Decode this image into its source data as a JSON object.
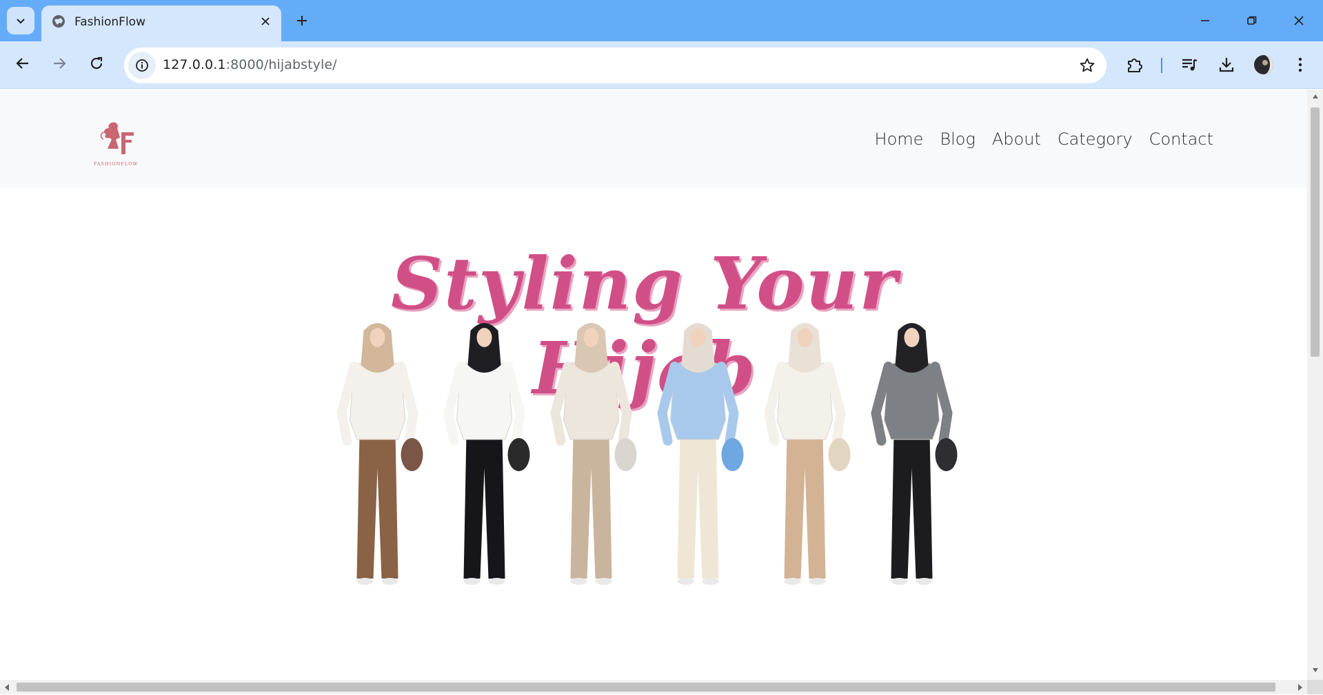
{
  "browser": {
    "tab": {
      "title": "FashionFlow",
      "icon": "globe-icon"
    },
    "address": {
      "host": "127.0.0.1",
      "path": ":8000/hijabstyle/"
    },
    "colors": {
      "tabstrip": "#64acf8",
      "toolbar": "#d5e7fc"
    }
  },
  "site": {
    "logo_text": "FASHIONFLOW",
    "nav": {
      "home": "Home",
      "blog": "Blog",
      "about": "About",
      "category": "Category",
      "contact": "Contact"
    },
    "hero": {
      "title": "Styling Your Hijab",
      "accent_color": "#d14f87",
      "outfits": [
        {
          "icon": "model-icon",
          "top": "#f4f1ec",
          "hijab": "#d2b79a",
          "pants": "#8a6246",
          "bag": "#7a5646"
        },
        {
          "icon": "model-icon",
          "top": "#f6f6f4",
          "hijab": "#1e1e22",
          "pants": "#16161a",
          "bag": "#2a2a2a"
        },
        {
          "icon": "model-icon",
          "top": "#ece6dc",
          "hijab": "#d9c6b3",
          "pants": "#c9b59e",
          "bag": "#d9d6d2"
        },
        {
          "icon": "model-icon",
          "top": "#a9c9ec",
          "hijab": "#e4dcd3",
          "pants": "#efe6d5",
          "bag": "#6fa7e3"
        },
        {
          "icon": "model-icon",
          "top": "#f4f1ea",
          "hijab": "#e9e1d6",
          "pants": "#d3b394",
          "bag": "#e3d6c1"
        },
        {
          "icon": "model-icon",
          "top": "#7d8084",
          "hijab": "#222226",
          "pants": "#1c1c1e",
          "bag": "#2e2e30"
        }
      ]
    }
  }
}
